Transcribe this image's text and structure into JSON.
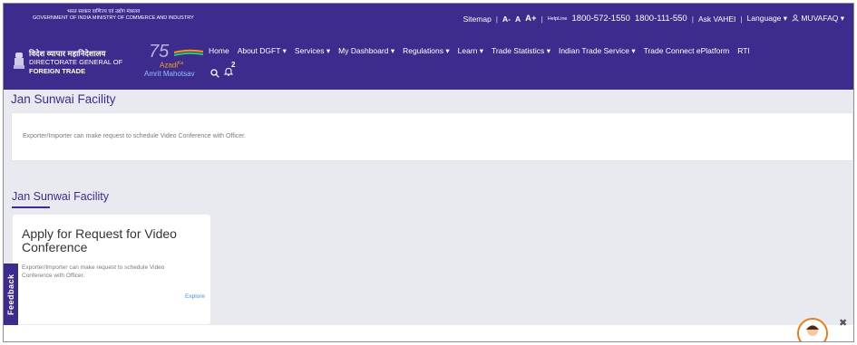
{
  "top_strip": {
    "hindi_line": "भारत सरकार  वाणिज्य एवं उद्योग मंत्रालय",
    "english_line": "GOVERNMENT OF INDIA  MINISTRY OF COMMERCE AND INDUSTRY",
    "sitemap": "Sitemap",
    "font_a_minus": "A-",
    "font_a": "A",
    "font_a_plus": "A+",
    "helpline_label": "HelpLine",
    "helpline_1": "1800-572-1550",
    "helpline_2": "1800-111-550",
    "ask_vahei": "Ask VAHEI",
    "language": "Language",
    "user": "MUVAFAQ"
  },
  "brand": {
    "hindi": "विदेश व्यापार महानिदेशालय",
    "line1": "DIRECTORATE GENERAL OF",
    "line2": "FOREIGN TRADE",
    "azadi_75": "75",
    "azadi_word": "Azadi",
    "azadi_ka": "Ka",
    "amrit": "Amrit Mahotsav"
  },
  "nav": {
    "items": [
      {
        "label": "Home",
        "caret": ""
      },
      {
        "label": "About DGFT",
        "caret": "▾"
      },
      {
        "label": "Services",
        "caret": "▾"
      },
      {
        "label": "My Dashboard",
        "caret": "▾"
      },
      {
        "label": "Regulations",
        "caret": "▾"
      },
      {
        "label": "Learn",
        "caret": "▾"
      },
      {
        "label": "Trade Statistics",
        "caret": "▾"
      },
      {
        "label": "Indian Trade Service",
        "caret": "▾"
      },
      {
        "label": "Trade Connect ePlatform",
        "caret": ""
      },
      {
        "label": "RTI",
        "caret": ""
      }
    ],
    "notification_count": "2",
    "search_icon": "search-icon",
    "bell_icon": "bell-icon"
  },
  "section1": {
    "title": "Jan Sunwai Facility",
    "description": "Exporter/Importer can make request to schedule Video Conference with Officer."
  },
  "section2": {
    "title": "Jan Sunwai Facility",
    "card_title": "Apply for Request for Video Conference",
    "card_desc": "Exporter/Importer can make request to schedule Video Conference with Officer.",
    "card_link": "Explore"
  },
  "feedback": "Feedback",
  "colors": {
    "primary": "#3e2b8e",
    "link": "#4a90e2",
    "band": "#e9e9f0"
  }
}
